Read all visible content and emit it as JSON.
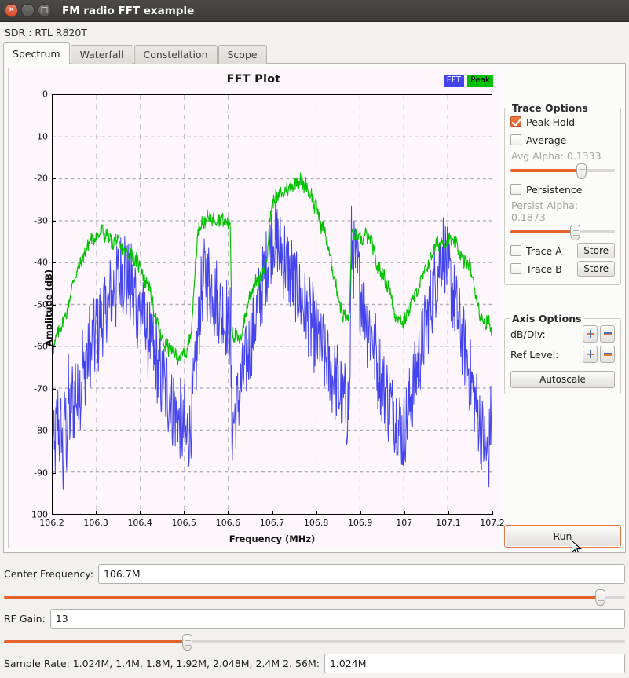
{
  "window": {
    "title": "FM radio FFT example",
    "buttons": {
      "close": "×",
      "minimize": "−",
      "maximize": "□"
    }
  },
  "device_label": "SDR : RTL R820T",
  "tabs": [
    {
      "label": "Spectrum",
      "active": true
    },
    {
      "label": "Waterfall",
      "active": false
    },
    {
      "label": "Constellation",
      "active": false
    },
    {
      "label": "Scope",
      "active": false
    }
  ],
  "trace_options": {
    "title": "Trace Options",
    "peak_hold": {
      "label": "Peak Hold",
      "checked": true
    },
    "average": {
      "label": "Average",
      "checked": false
    },
    "avg_alpha": {
      "label": "Avg Alpha: 0.1333",
      "value": 0.1333,
      "percent": 68
    },
    "persistence": {
      "label": "Persistence",
      "checked": false
    },
    "persist_alpha": {
      "label": "Persist Alpha: 0.1873",
      "value": 0.1873,
      "percent": 62
    },
    "trace_a": {
      "label": "Trace A",
      "checked": false,
      "store_label": "Store"
    },
    "trace_b": {
      "label": "Trace B",
      "checked": false,
      "store_label": "Store"
    }
  },
  "axis_options": {
    "title": "Axis Options",
    "db_div": {
      "label": "dB/Div:",
      "plus": "+",
      "minus": "-"
    },
    "ref_level": {
      "label": "Ref Level:",
      "plus": "+",
      "minus": "-"
    },
    "autoscale_label": "Autoscale"
  },
  "run_button": {
    "label": "Run"
  },
  "bottom": {
    "center_frequency": {
      "label": "Center Frequency:",
      "value": "106.7M",
      "slider_percent": 96
    },
    "rf_gain": {
      "label": "RF Gain:",
      "value": "13",
      "slider_percent": 29.5
    },
    "sample_rate": {
      "label": "Sample Rate: 1.024M, 1.4M, 1.8M, 1.92M, 2.048M, 2.4M  2. 56M:",
      "value": "1.024M"
    }
  },
  "chart_data": {
    "type": "line",
    "title": "FFT Plot",
    "xlabel": "Frequency (MHz)",
    "ylabel": "Amplitude (dB)",
    "xlim": [
      106.2,
      107.2
    ],
    "ylim": [
      -100,
      0
    ],
    "xticks": [
      "106.2",
      "106.3",
      "106.4",
      "106.5",
      "106.6",
      "106.7",
      "106.8",
      "106.9",
      "107",
      "107.1",
      "107.2"
    ],
    "yticks": [
      "0",
      "-10",
      "-20",
      "-30",
      "-40",
      "-50",
      "-60",
      "-70",
      "-80",
      "-90",
      "-100"
    ],
    "grid": true,
    "legend": [
      {
        "name": "FFT",
        "color": "#4444ee"
      },
      {
        "name": "Peak",
        "color": "#00c000"
      }
    ],
    "series": [
      {
        "name": "Peak",
        "color": "#00c000",
        "values": [
          -61,
          -60,
          -58,
          -57,
          -56,
          -55,
          -54,
          -53,
          -52,
          -50,
          -48,
          -46,
          -44,
          -43,
          -42,
          -41,
          -40,
          -39,
          -38,
          -37,
          -36,
          -35,
          -34,
          -35,
          -34,
          -33,
          -34,
          -33,
          -32,
          -33,
          -34,
          -33,
          -35,
          -34,
          -36,
          -35,
          -34,
          -35,
          -36,
          -37,
          -36,
          -38,
          -37,
          -39,
          -38,
          -37,
          -39,
          -40,
          -39,
          -41,
          -40,
          -42,
          -44,
          -45,
          -44,
          -46,
          -48,
          -50,
          -52,
          -54,
          -55,
          -57,
          -58,
          -59,
          -60,
          -59,
          -61,
          -60,
          -62,
          -61,
          -62,
          -63,
          -62,
          -63,
          -62,
          -61,
          -62,
          -60,
          -58,
          -55,
          -50,
          -42,
          -36,
          -32,
          -31,
          -30,
          -31,
          -30,
          -29,
          -30,
          -29,
          -30,
          -29,
          -30,
          -29,
          -30,
          -29,
          -30,
          -31,
          -30,
          -31,
          -30,
          -55,
          -58,
          -57,
          -58,
          -59,
          -58,
          -56,
          -54,
          -52,
          -50,
          -48,
          -47,
          -46,
          -45,
          -44,
          -45,
          -44,
          -43,
          -42,
          -40,
          -38,
          -33,
          -28,
          -26,
          -25,
          -24,
          -25,
          -24,
          -23,
          -24,
          -23,
          -22,
          -23,
          -22,
          -21,
          -22,
          -21,
          -20,
          -21,
          -20,
          -21,
          -22,
          -21,
          -22,
          -24,
          -23,
          -25,
          -27,
          -26,
          -28,
          -30,
          -32,
          -31,
          -33,
          -35,
          -37,
          -39,
          -41,
          -43,
          -45,
          -47,
          -49,
          -51,
          -53,
          -52,
          -54,
          -53,
          -52,
          -33,
          -34,
          -33,
          -34,
          -35,
          -34,
          -35,
          -34,
          -33,
          -34,
          -35,
          -34,
          -36,
          -38,
          -40,
          -42,
          -41,
          -43,
          -42,
          -44,
          -46,
          -45,
          -47,
          -49,
          -51,
          -53,
          -52,
          -54,
          -53,
          -55,
          -54,
          -53,
          -52,
          -51,
          -50,
          -49,
          -48,
          -47,
          -46,
          -45,
          -44,
          -43,
          -42,
          -41,
          -40,
          -39,
          -38,
          -37,
          -36,
          -35,
          -36,
          -35,
          -34,
          -35,
          -36,
          -35,
          -34,
          -35,
          -36,
          -35,
          -36,
          -37,
          -38,
          -39,
          -40,
          -39,
          -41,
          -40,
          -42,
          -44,
          -46,
          -48,
          -50,
          -52,
          -54,
          -53,
          -55,
          -54,
          -53,
          -56
        ]
      },
      {
        "name": "FFT",
        "color": "#4444ee",
        "values": [
          -75,
          -88,
          -80,
          -76,
          -82,
          -78,
          -90,
          -74,
          -83,
          -71,
          -79,
          -70,
          -76,
          -68,
          -75,
          -66,
          -72,
          -62,
          -70,
          -60,
          -65,
          -58,
          -63,
          -56,
          -60,
          -54,
          -58,
          -52,
          -56,
          -50,
          -54,
          -48,
          -52,
          -46,
          -50,
          -44,
          -48,
          -42,
          -46,
          -40,
          -45,
          -39,
          -47,
          -41,
          -49,
          -43,
          -51,
          -45,
          -53,
          -47,
          -55,
          -49,
          -57,
          -52,
          -60,
          -55,
          -63,
          -58,
          -66,
          -61,
          -68,
          -64,
          -70,
          -66,
          -72,
          -68,
          -74,
          -70,
          -76,
          -72,
          -78,
          -74,
          -80,
          -76,
          -82,
          -78,
          -84,
          -79,
          -81,
          -76,
          -72,
          -68,
          -62,
          -56,
          -50,
          -46,
          -44,
          -42,
          -45,
          -43,
          -48,
          -44,
          -50,
          -46,
          -52,
          -48,
          -54,
          -50,
          -56,
          -52,
          -58,
          -54,
          -80,
          -78,
          -76,
          -74,
          -72,
          -70,
          -68,
          -66,
          -64,
          -62,
          -60,
          -58,
          -56,
          -54,
          -52,
          -50,
          -48,
          -46,
          -44,
          -42,
          -40,
          -38,
          -36,
          -34,
          -33,
          -36,
          -34,
          -38,
          -36,
          -40,
          -38,
          -42,
          -40,
          -44,
          -42,
          -46,
          -44,
          -48,
          -46,
          -50,
          -48,
          -52,
          -50,
          -54,
          -52,
          -56,
          -54,
          -58,
          -56,
          -60,
          -58,
          -62,
          -60,
          -64,
          -62,
          -66,
          -64,
          -68,
          -66,
          -70,
          -68,
          -72,
          -70,
          -74,
          -72,
          -76,
          -74,
          -72,
          -35,
          -40,
          -38,
          -44,
          -42,
          -48,
          -46,
          -52,
          -50,
          -56,
          -54,
          -58,
          -56,
          -62,
          -60,
          -66,
          -64,
          -70,
          -68,
          -72,
          -70,
          -74,
          -72,
          -76,
          -74,
          -78,
          -76,
          -80,
          -78,
          -82,
          -80,
          -78,
          -76,
          -74,
          -72,
          -70,
          -68,
          -66,
          -64,
          -62,
          -60,
          -58,
          -56,
          -54,
          -52,
          -50,
          -48,
          -46,
          -44,
          -42,
          -40,
          -38,
          -36,
          -38,
          -40,
          -42,
          -44,
          -46,
          -48,
          -50,
          -52,
          -54,
          -56,
          -58,
          -60,
          -62,
          -64,
          -66,
          -68,
          -70,
          -72,
          -74,
          -76,
          -78,
          -80,
          -82,
          -84,
          -86,
          -88,
          -78
        ]
      }
    ]
  }
}
